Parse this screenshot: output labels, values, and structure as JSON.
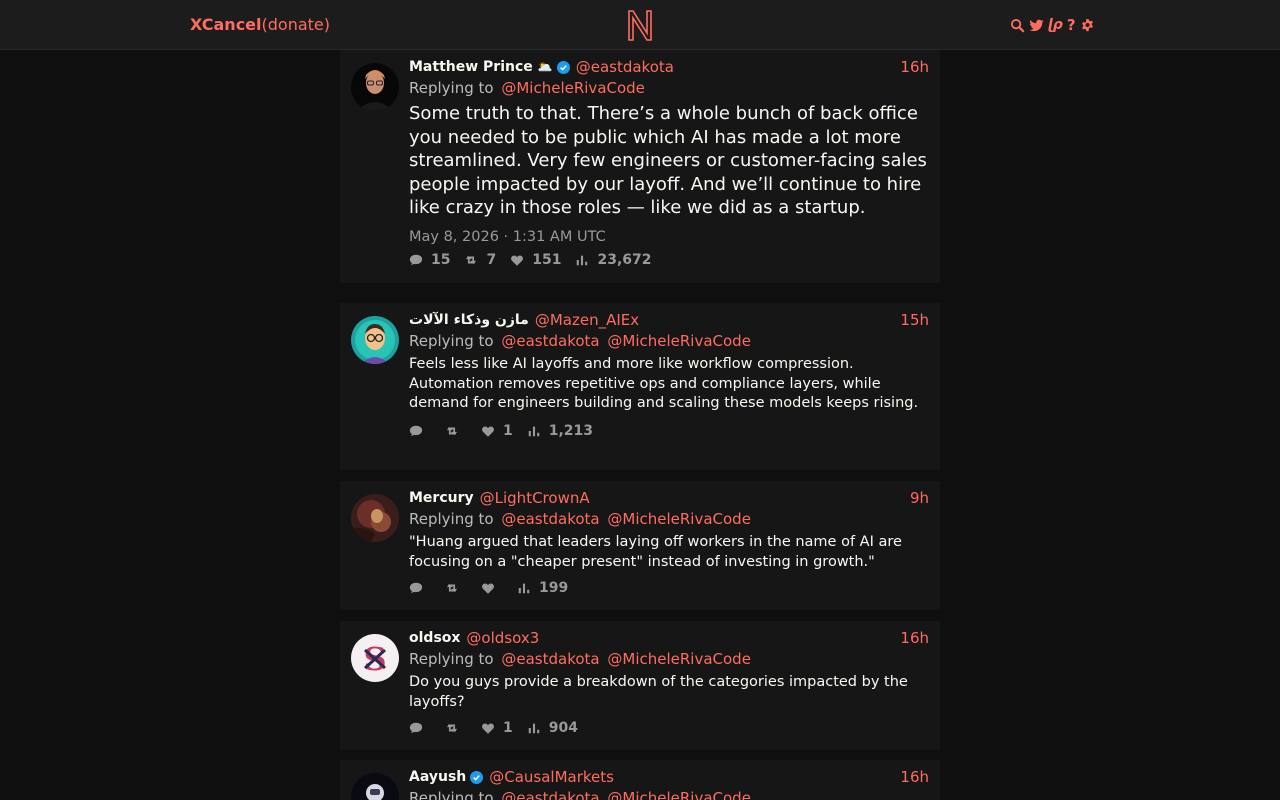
{
  "nav": {
    "brand": "XCancel",
    "donate": "(donate)",
    "logo_letter": "N",
    "icons": [
      "search-icon",
      "bird-icon",
      "rss-icon",
      "help-icon",
      "gear-icon"
    ],
    "accent_color": "#ff6c60"
  },
  "tweets": [
    {
      "fullname": "Matthew Prince",
      "emoji": "🌥️",
      "verified": true,
      "username": "@eastdakota",
      "date": "16h",
      "replying_label": "Replying to",
      "replying_to": [
        "@MicheleRivaCode"
      ],
      "content": "Some truth to that. There’s a whole bunch of back office you needed to be public which AI has made a lot more streamlined. Very few engineers or customer-facing sales people impacted by our layoff. And we’ll continue to hire like crazy in those roles — like we did as a startup.",
      "published": "May 8, 2026 · 1:31 AM UTC",
      "stats": {
        "comments": "15",
        "retweets": "7",
        "likes": "151",
        "views": "23,672"
      }
    },
    {
      "fullname": "مازن وذكاء الآلات",
      "verified": false,
      "username": "@Mazen_AIEx",
      "date": "15h",
      "replying_label": "Replying to",
      "replying_to": [
        "@eastdakota",
        "@MicheleRivaCode"
      ],
      "content": "Feels less like AI layoffs and more like workflow compression. Automation removes repetitive ops and compliance layers, while demand for engineers building and scaling these models keeps rising.",
      "stats": {
        "comments": "",
        "retweets": "",
        "likes": "1",
        "views": "1,213"
      }
    },
    {
      "fullname": "Mercury",
      "verified": false,
      "username": "@LightCrownA",
      "date": "9h",
      "replying_label": "Replying to",
      "replying_to": [
        "@eastdakota",
        "@MicheleRivaCode"
      ],
      "content": "\"Huang argued that leaders laying off workers in the name of AI are focusing on a \"cheaper present\" instead of investing in growth.\"",
      "stats": {
        "comments": "",
        "retweets": "",
        "likes": "",
        "views": "199"
      }
    },
    {
      "fullname": "oldsox",
      "verified": false,
      "username": "@oldsox3",
      "date": "16h",
      "replying_label": "Replying to",
      "replying_to": [
        "@eastdakota",
        "@MicheleRivaCode"
      ],
      "content": "Do you guys provide a breakdown of the categories impacted by the layoffs?",
      "stats": {
        "comments": "",
        "retweets": "",
        "likes": "1",
        "views": "904"
      }
    },
    {
      "fullname": "Aayush",
      "verified": true,
      "username": "@CausalMarkets",
      "date": "16h",
      "replying_label": "Replying to",
      "replying_to": [
        "@eastdakota",
        "@MicheleRivaCode"
      ]
    }
  ]
}
